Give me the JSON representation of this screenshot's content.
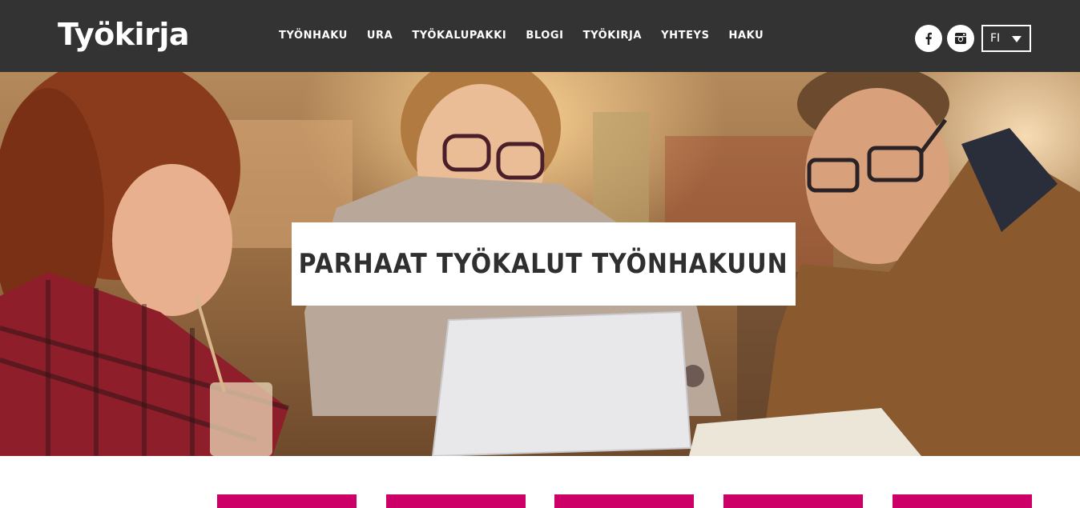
{
  "brand": {
    "logo_text": "Työkirja"
  },
  "nav": {
    "items": [
      {
        "label": "TYÖNHAKU"
      },
      {
        "label": "URA"
      },
      {
        "label": "TYÖKALUPAKKI"
      },
      {
        "label": "BLOGI"
      },
      {
        "label": "TYÖKIRJA"
      },
      {
        "label": "YHTEYS"
      },
      {
        "label": "HAKU"
      }
    ]
  },
  "social": {
    "facebook_icon": "facebook-icon",
    "instagram_icon": "instagram-icon"
  },
  "language": {
    "selected": "FI"
  },
  "hero": {
    "title": "PARHAAT TYÖKALUT TYÖNHAKUUN",
    "image": "three-people-looking-at-laptop-photo"
  },
  "tiles": {
    "count": 5,
    "color": "#cc0066"
  },
  "colors": {
    "header_bg": "#333333",
    "accent": "#cc0066",
    "title_text": "#2f2f2f"
  }
}
